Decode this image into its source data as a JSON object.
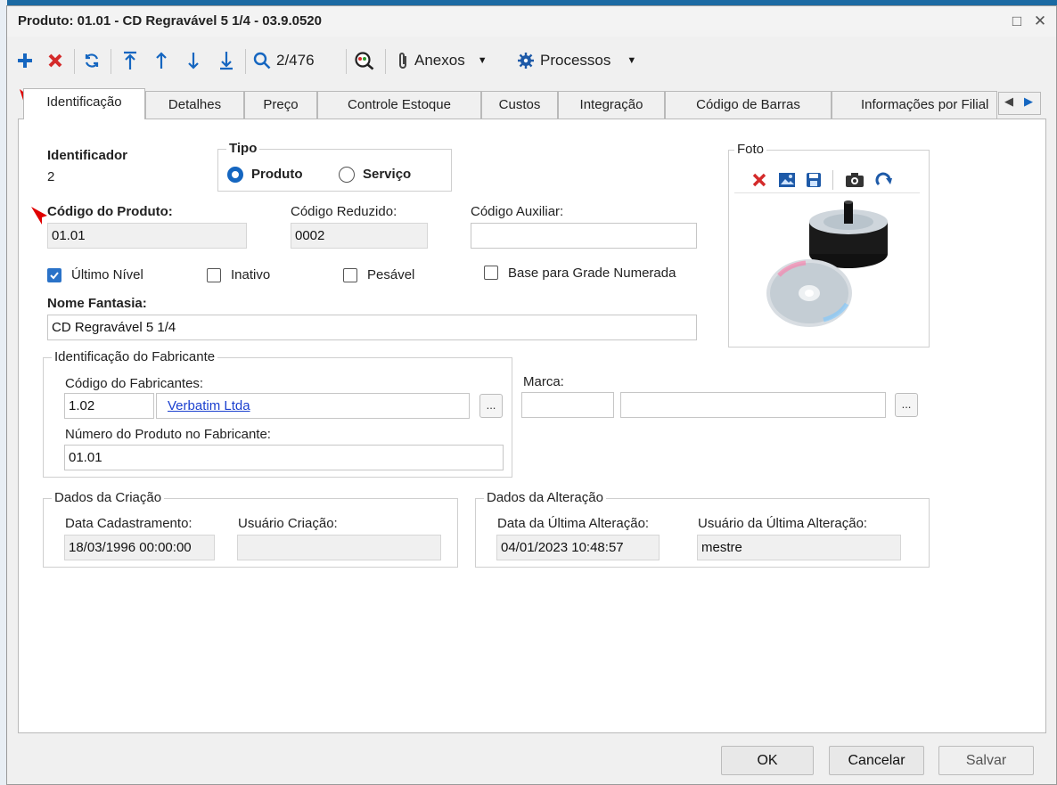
{
  "window": {
    "title": "Produto: 01.01 - CD Regravável 5 1/4 - 03.9.0520",
    "maximize_glyph": "□",
    "close_glyph": "✕"
  },
  "toolbar": {
    "record_position": "2/476",
    "anexos_label": "Anexos",
    "processos_label": "Processos",
    "icons": [
      "add-icon",
      "delete-icon",
      "refresh-icon",
      "first-record-icon",
      "previous-record-icon",
      "next-record-icon",
      "last-record-icon",
      "search-icon",
      "advanced-search-icon",
      "paperclip-icon",
      "gear-icon"
    ]
  },
  "tabs": [
    "Identificação",
    "Detalhes",
    "Preço",
    "Controle Estoque",
    "Custos",
    "Integração",
    "Código de Barras",
    "Informações por Filial"
  ],
  "identificacao": {
    "identificador_label": "Identificador",
    "identificador_value": "2",
    "tipo_label": "Tipo",
    "tipo_produto": "Produto",
    "tipo_servico": "Serviço",
    "codigo_produto_label": "Código do Produto:",
    "codigo_produto_value": "01.01",
    "codigo_reduzido_label": "Código Reduzido:",
    "codigo_reduzido_value": "0002",
    "codigo_auxiliar_label": "Código Auxiliar:",
    "codigo_auxiliar_value": "",
    "ultimo_nivel_label": "Último Nível",
    "inativo_label": "Inativo",
    "pesavel_label": "Pesável",
    "base_grade_label": "Base para Grade Numerada",
    "nome_fantasia_label": "Nome Fantasia:",
    "nome_fantasia_value": "CD Regravável 5 1/4"
  },
  "foto": {
    "label": "Foto"
  },
  "fabricante": {
    "group_title": "Identificação do Fabricante",
    "codigo_label": "Código do Fabricantes:",
    "codigo_value": "1.02",
    "nome_value": "Verbatim Ltda",
    "numero_label": "Número do Produto no Fabricante:",
    "numero_value": "01.01",
    "marca_label": "Marca:",
    "ellipsis": "..."
  },
  "criacao": {
    "group_title": "Dados da Criação",
    "data_label": "Data Cadastramento:",
    "data_value": "18/03/1996 00:00:00",
    "usuario_label": "Usuário Criação:",
    "usuario_value": ""
  },
  "alteracao": {
    "group_title": "Dados da Alteração",
    "data_label": "Data da Última Alteração:",
    "data_value": "04/01/2023 10:48:57",
    "usuario_label": "Usuário da Última Alteração:",
    "usuario_value": "mestre"
  },
  "footer": {
    "ok": "OK",
    "cancelar": "Cancelar",
    "salvar": "Salvar"
  },
  "colors": {
    "accent_blue": "#1566c0",
    "danger_red": "#d42a2a",
    "annotation_red": "#e00000"
  }
}
